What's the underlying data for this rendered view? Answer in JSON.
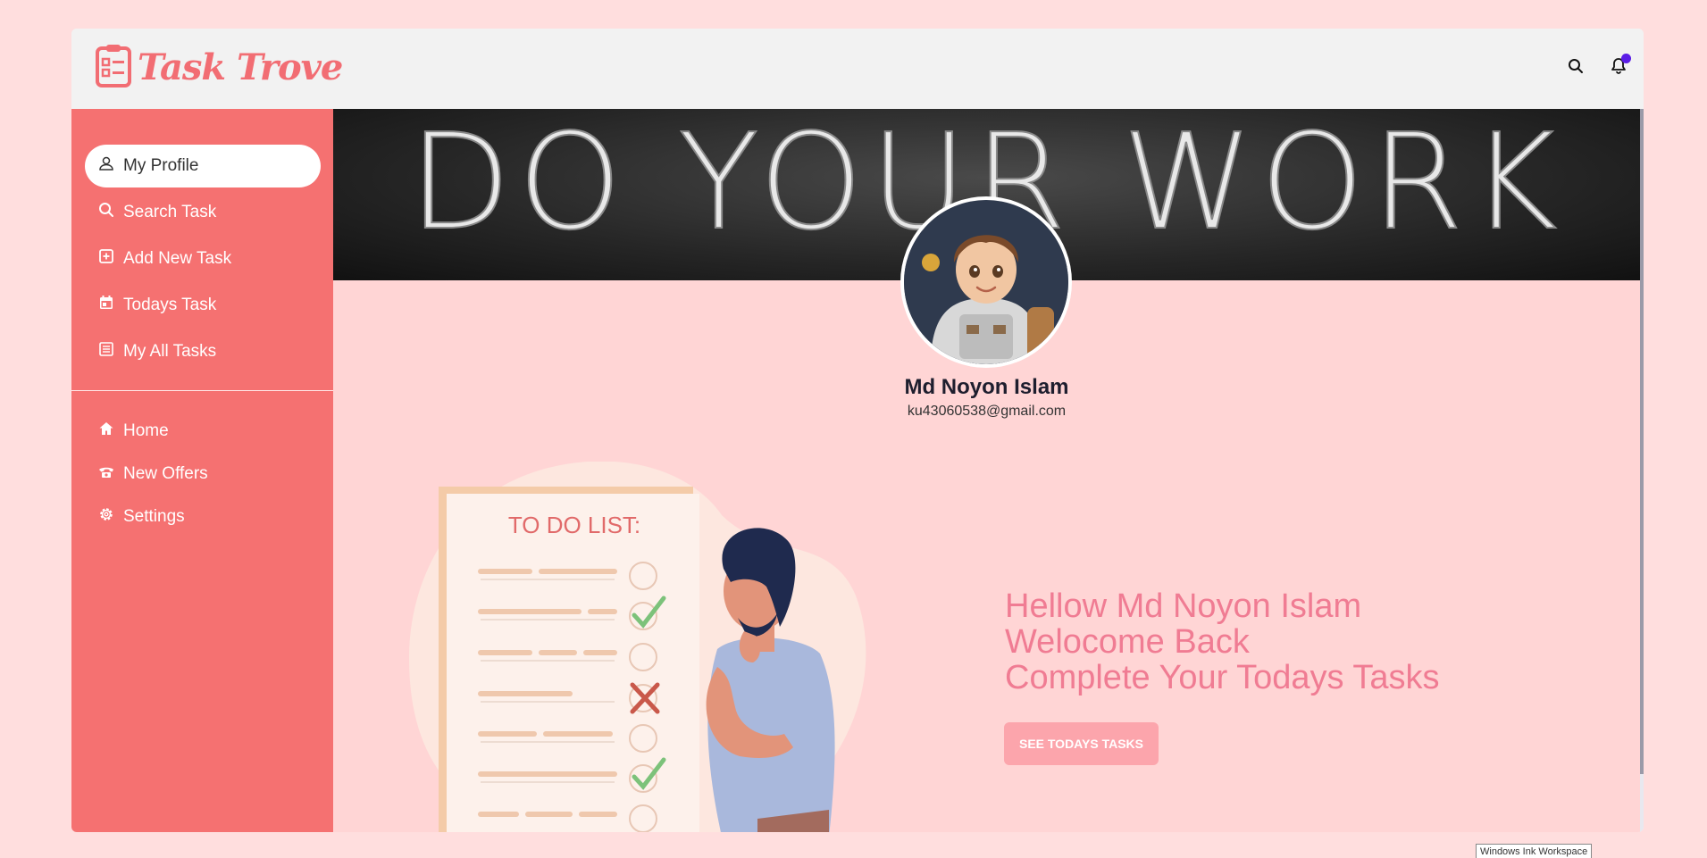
{
  "app": {
    "logo_text": "Task Trove",
    "brand_color": "#f26d73",
    "sidebar_color": "#f57171"
  },
  "topbar": {
    "search_icon": "search-icon",
    "notification_icon": "bell-icon",
    "notification_dot_color": "#5b1de6"
  },
  "sidebar": {
    "items": [
      {
        "label": "My Profile",
        "icon": "user-icon",
        "active": true
      },
      {
        "label": "Search Task",
        "icon": "search-icon"
      },
      {
        "label": "Add New Task",
        "icon": "plus-square-icon"
      },
      {
        "label": "Todays Task",
        "icon": "calendar-icon"
      },
      {
        "label": "My All Tasks",
        "icon": "list-icon"
      }
    ],
    "secondary_items": [
      {
        "label": "Home",
        "icon": "home-icon"
      },
      {
        "label": "New Offers",
        "icon": "phone-icon"
      },
      {
        "label": "Settings",
        "icon": "gear-icon"
      }
    ]
  },
  "banner": {
    "text": "DO YOUR WORK"
  },
  "profile": {
    "name": "Md Noyon Islam",
    "email": "ku43060538@gmail.com"
  },
  "illustration": {
    "title": "TO DO LIST:"
  },
  "welcome": {
    "line1": "Hellow Md Noyon Islam",
    "line2": "Welocome Back",
    "line3": "Complete Your Todays Tasks",
    "cta_label": "SEE TODAYS TASKS"
  },
  "os": {
    "tooltip": "Windows Ink Workspace"
  }
}
